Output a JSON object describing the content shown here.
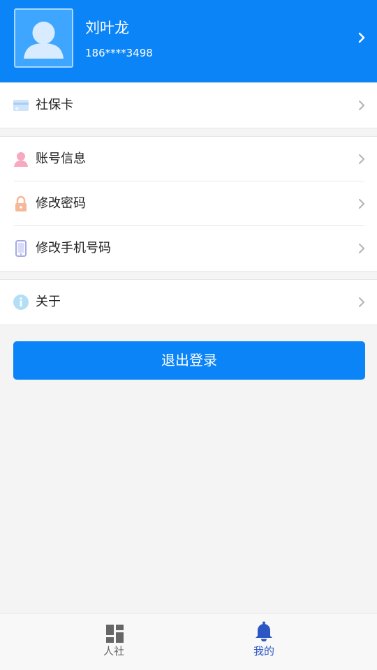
{
  "profile": {
    "name": "刘叶龙",
    "phone": "186****3498"
  },
  "groups": [
    {
      "items": [
        {
          "label": "社保卡",
          "icon": "card-icon"
        }
      ]
    },
    {
      "items": [
        {
          "label": "账号信息",
          "icon": "person-icon"
        },
        {
          "label": "修改密码",
          "icon": "lock-icon"
        },
        {
          "label": "修改手机号码",
          "icon": "phone-icon"
        }
      ]
    },
    {
      "items": [
        {
          "label": "关于",
          "icon": "info-icon"
        }
      ]
    }
  ],
  "logout_label": "退出登录",
  "tabs": [
    {
      "label": "人社",
      "icon": "grid-icon",
      "active": false
    },
    {
      "label": "我的",
      "icon": "bell-icon",
      "active": true
    }
  ],
  "colors": {
    "primary": "#0a84f7",
    "tab_active": "#2b56c4",
    "tab_inactive": "#666666"
  }
}
